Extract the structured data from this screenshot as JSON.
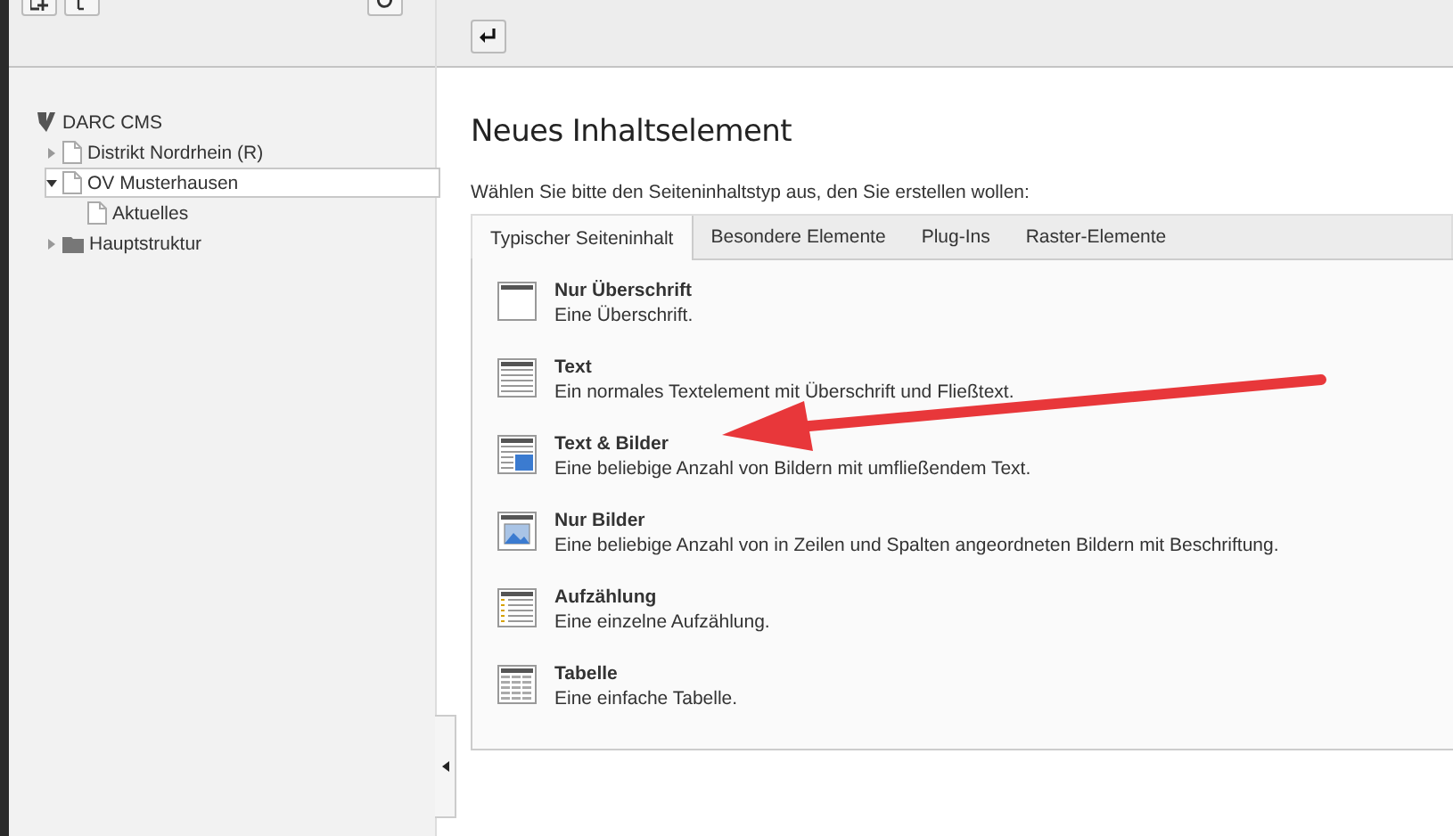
{
  "tree": [
    {
      "label": "DARC CMS",
      "kind": "site",
      "selected": false,
      "children": [
        {
          "label": "Distrikt Nordrhein (R)",
          "kind": "page",
          "expanded": false,
          "has_children": true,
          "selected": false
        },
        {
          "label": "OV Musterhausen",
          "kind": "page",
          "expanded": true,
          "has_children": true,
          "selected": true,
          "children": [
            {
              "label": "Aktuelles",
              "kind": "page",
              "expanded": false,
              "has_children": false,
              "selected": false
            }
          ]
        },
        {
          "label": "Hauptstruktur",
          "kind": "folder",
          "expanded": false,
          "has_children": true,
          "selected": false
        }
      ]
    }
  ],
  "heading": "Neues Inhaltselement",
  "intro": "Wählen Sie bitte den Seiteninhaltstyp aus, den Sie erstellen wollen:",
  "tabs": [
    {
      "label": "Typischer Seiteninhalt",
      "selected": true
    },
    {
      "label": "Besondere Elemente",
      "selected": false
    },
    {
      "label": "Plug-Ins",
      "selected": false
    },
    {
      "label": "Raster-Elemente",
      "selected": false
    }
  ],
  "elements": [
    {
      "kind": "header",
      "title": "Nur Überschrift",
      "description": "Eine Überschrift."
    },
    {
      "kind": "text",
      "title": "Text",
      "description": "Ein normales Textelement mit Überschrift und Fließtext."
    },
    {
      "kind": "textpic",
      "title": "Text & Bilder",
      "description": "Eine beliebige Anzahl von Bildern mit umfließendem Text."
    },
    {
      "kind": "image",
      "title": "Nur Bilder",
      "description": "Eine beliebige Anzahl von in Zeilen und Spalten angeordneten Bildern mit Beschriftung."
    },
    {
      "kind": "bullets",
      "title": "Aufzählung",
      "description": "Eine einzelne Aufzählung."
    },
    {
      "kind": "table",
      "title": "Tabelle",
      "description": "Eine einfache Tabelle."
    }
  ]
}
